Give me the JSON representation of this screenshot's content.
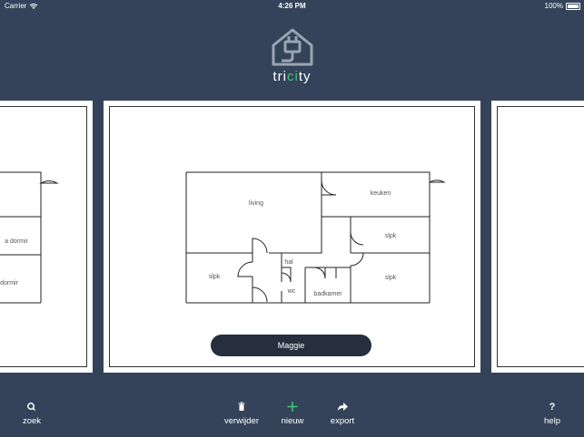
{
  "status": {
    "carrier": "Carrier",
    "time": "4:26 PM",
    "battery": "100%"
  },
  "brand": {
    "name_start": "tri",
    "name_accent": "ci",
    "name_end": "ty",
    "accent_color": "#3ec27a"
  },
  "main_card": {
    "rooms": {
      "living": "living",
      "keuken": "keuken",
      "slpk_top": "slpk",
      "slpk_left": "slpk",
      "slpk_right": "slpk",
      "hal": "hal",
      "wc": "wc",
      "badkamer": "badkamer"
    },
    "button_label": "Maggie"
  },
  "left_card": {
    "rooms": {
      "a": "a dormir",
      "b": "dormir"
    }
  },
  "toolbar": {
    "zoek": "zoek",
    "verwijder": "verwijder",
    "nieuw": "nieuw",
    "export": "export",
    "help": "help",
    "help_icon": "?"
  },
  "icons": [
    "search-icon",
    "trash-icon",
    "plus-icon",
    "share-icon",
    "help-icon",
    "house-plug-icon",
    "wifi-icon",
    "battery-icon"
  ]
}
